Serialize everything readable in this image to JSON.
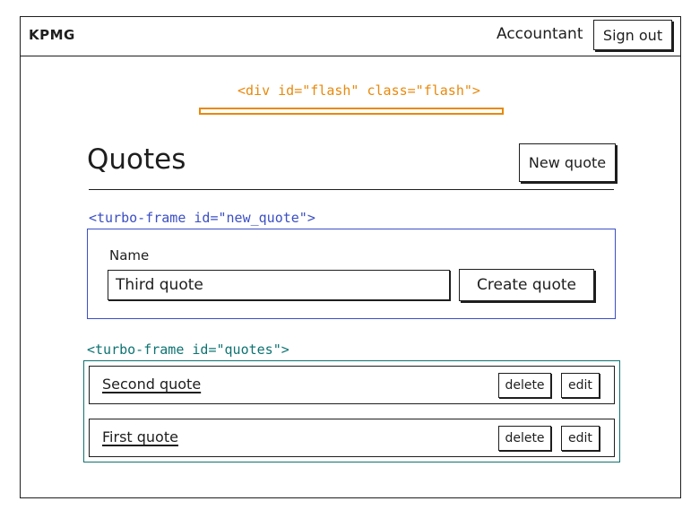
{
  "navbar": {
    "brand": "KPMG",
    "role": "Accountant",
    "signout_label": "Sign out"
  },
  "flash": {
    "label": "<div id=\"flash\" class=\"flash\">",
    "color": "#e8890c"
  },
  "main": {
    "title": "Quotes",
    "new_quote_label": "New quote"
  },
  "new_quote_frame": {
    "label": "<turbo-frame id=\"new_quote\">",
    "color": "#3b4fc4",
    "name_label": "Name",
    "name_value": "Third quote",
    "create_label": "Create quote"
  },
  "quotes_frame": {
    "label": "<turbo-frame id=\"quotes\">",
    "color": "#0e7372",
    "quotes": [
      {
        "name": "Second quote",
        "delete_label": "delete",
        "edit_label": "edit"
      },
      {
        "name": "First quote",
        "delete_label": "delete",
        "edit_label": "edit"
      }
    ]
  }
}
